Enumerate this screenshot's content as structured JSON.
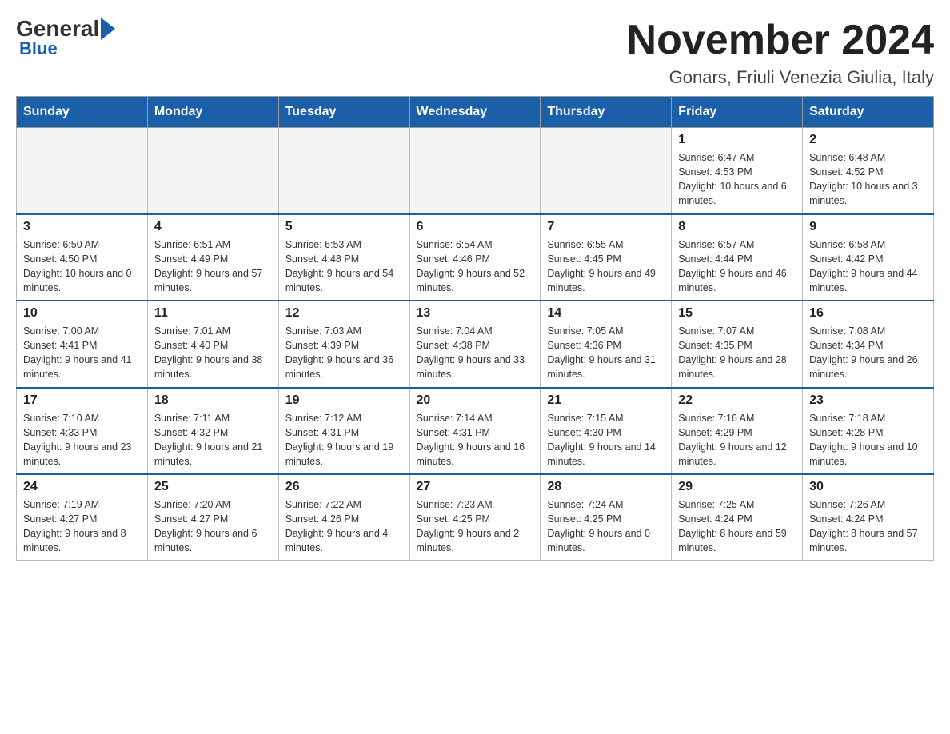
{
  "header": {
    "logo_general": "General",
    "logo_blue": "Blue",
    "title": "November 2024",
    "subtitle": "Gonars, Friuli Venezia Giulia, Italy"
  },
  "weekdays": [
    "Sunday",
    "Monday",
    "Tuesday",
    "Wednesday",
    "Thursday",
    "Friday",
    "Saturday"
  ],
  "weeks": [
    [
      {
        "day": "",
        "empty": true
      },
      {
        "day": "",
        "empty": true
      },
      {
        "day": "",
        "empty": true
      },
      {
        "day": "",
        "empty": true
      },
      {
        "day": "",
        "empty": true
      },
      {
        "day": "1",
        "sunrise": "6:47 AM",
        "sunset": "4:53 PM",
        "daylight": "10 hours and 6 minutes."
      },
      {
        "day": "2",
        "sunrise": "6:48 AM",
        "sunset": "4:52 PM",
        "daylight": "10 hours and 3 minutes."
      }
    ],
    [
      {
        "day": "3",
        "sunrise": "6:50 AM",
        "sunset": "4:50 PM",
        "daylight": "10 hours and 0 minutes."
      },
      {
        "day": "4",
        "sunrise": "6:51 AM",
        "sunset": "4:49 PM",
        "daylight": "9 hours and 57 minutes."
      },
      {
        "day": "5",
        "sunrise": "6:53 AM",
        "sunset": "4:48 PM",
        "daylight": "9 hours and 54 minutes."
      },
      {
        "day": "6",
        "sunrise": "6:54 AM",
        "sunset": "4:46 PM",
        "daylight": "9 hours and 52 minutes."
      },
      {
        "day": "7",
        "sunrise": "6:55 AM",
        "sunset": "4:45 PM",
        "daylight": "9 hours and 49 minutes."
      },
      {
        "day": "8",
        "sunrise": "6:57 AM",
        "sunset": "4:44 PM",
        "daylight": "9 hours and 46 minutes."
      },
      {
        "day": "9",
        "sunrise": "6:58 AM",
        "sunset": "4:42 PM",
        "daylight": "9 hours and 44 minutes."
      }
    ],
    [
      {
        "day": "10",
        "sunrise": "7:00 AM",
        "sunset": "4:41 PM",
        "daylight": "9 hours and 41 minutes."
      },
      {
        "day": "11",
        "sunrise": "7:01 AM",
        "sunset": "4:40 PM",
        "daylight": "9 hours and 38 minutes."
      },
      {
        "day": "12",
        "sunrise": "7:03 AM",
        "sunset": "4:39 PM",
        "daylight": "9 hours and 36 minutes."
      },
      {
        "day": "13",
        "sunrise": "7:04 AM",
        "sunset": "4:38 PM",
        "daylight": "9 hours and 33 minutes."
      },
      {
        "day": "14",
        "sunrise": "7:05 AM",
        "sunset": "4:36 PM",
        "daylight": "9 hours and 31 minutes."
      },
      {
        "day": "15",
        "sunrise": "7:07 AM",
        "sunset": "4:35 PM",
        "daylight": "9 hours and 28 minutes."
      },
      {
        "day": "16",
        "sunrise": "7:08 AM",
        "sunset": "4:34 PM",
        "daylight": "9 hours and 26 minutes."
      }
    ],
    [
      {
        "day": "17",
        "sunrise": "7:10 AM",
        "sunset": "4:33 PM",
        "daylight": "9 hours and 23 minutes."
      },
      {
        "day": "18",
        "sunrise": "7:11 AM",
        "sunset": "4:32 PM",
        "daylight": "9 hours and 21 minutes."
      },
      {
        "day": "19",
        "sunrise": "7:12 AM",
        "sunset": "4:31 PM",
        "daylight": "9 hours and 19 minutes."
      },
      {
        "day": "20",
        "sunrise": "7:14 AM",
        "sunset": "4:31 PM",
        "daylight": "9 hours and 16 minutes."
      },
      {
        "day": "21",
        "sunrise": "7:15 AM",
        "sunset": "4:30 PM",
        "daylight": "9 hours and 14 minutes."
      },
      {
        "day": "22",
        "sunrise": "7:16 AM",
        "sunset": "4:29 PM",
        "daylight": "9 hours and 12 minutes."
      },
      {
        "day": "23",
        "sunrise": "7:18 AM",
        "sunset": "4:28 PM",
        "daylight": "9 hours and 10 minutes."
      }
    ],
    [
      {
        "day": "24",
        "sunrise": "7:19 AM",
        "sunset": "4:27 PM",
        "daylight": "9 hours and 8 minutes."
      },
      {
        "day": "25",
        "sunrise": "7:20 AM",
        "sunset": "4:27 PM",
        "daylight": "9 hours and 6 minutes."
      },
      {
        "day": "26",
        "sunrise": "7:22 AM",
        "sunset": "4:26 PM",
        "daylight": "9 hours and 4 minutes."
      },
      {
        "day": "27",
        "sunrise": "7:23 AM",
        "sunset": "4:25 PM",
        "daylight": "9 hours and 2 minutes."
      },
      {
        "day": "28",
        "sunrise": "7:24 AM",
        "sunset": "4:25 PM",
        "daylight": "9 hours and 0 minutes."
      },
      {
        "day": "29",
        "sunrise": "7:25 AM",
        "sunset": "4:24 PM",
        "daylight": "8 hours and 59 minutes."
      },
      {
        "day": "30",
        "sunrise": "7:26 AM",
        "sunset": "4:24 PM",
        "daylight": "8 hours and 57 minutes."
      }
    ]
  ]
}
